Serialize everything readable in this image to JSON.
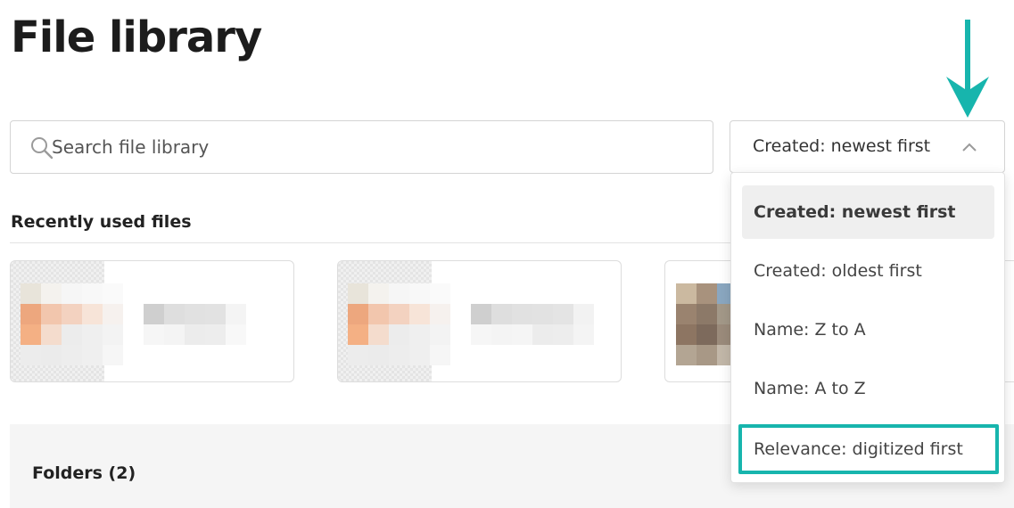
{
  "header": {
    "title": "File library"
  },
  "search": {
    "placeholder": "Search file library",
    "value": ""
  },
  "sort": {
    "selected_label": "Created: newest first",
    "options": [
      {
        "label": "Created: newest first",
        "selected": true
      },
      {
        "label": "Created: oldest first",
        "selected": false
      },
      {
        "label": "Name: Z to A",
        "selected": false
      },
      {
        "label": "Name: A to Z",
        "selected": false
      },
      {
        "label": "Relevance: digitized first",
        "selected": false,
        "highlighted": true
      }
    ]
  },
  "recent": {
    "heading": "Recently used files"
  },
  "folders": {
    "heading": "Folders (2)"
  },
  "colors": {
    "accent": "#17b5ad",
    "text": "#222222",
    "border": "#d4d4d4"
  },
  "icons": {
    "search": "search-icon",
    "chevron": "chevron-up-icon",
    "callout": "arrow-down-icon"
  }
}
